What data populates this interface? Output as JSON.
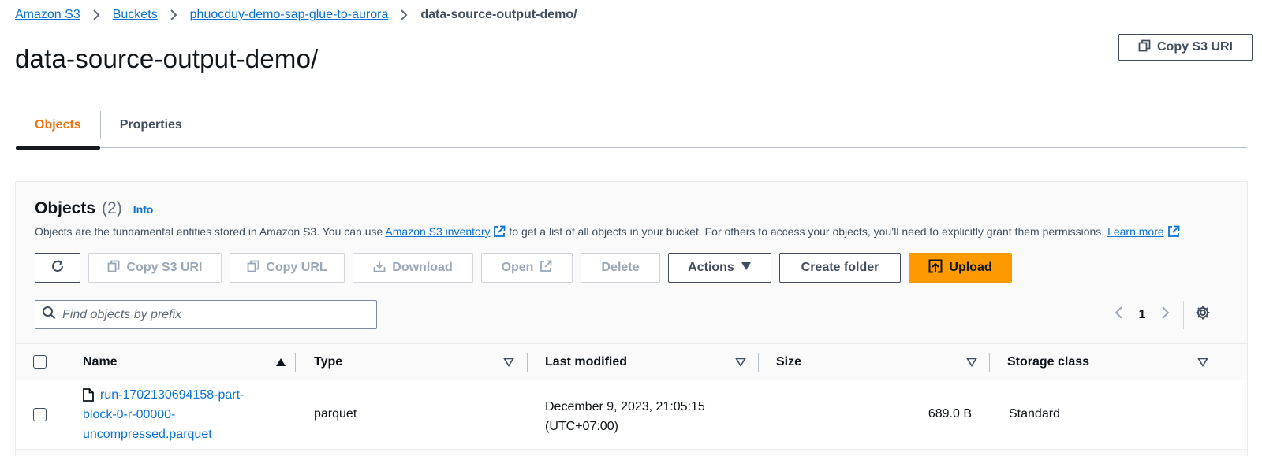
{
  "breadcrumb": {
    "items": [
      "Amazon S3",
      "Buckets",
      "phuocduy-demo-sap-glue-to-aurora"
    ],
    "current": "data-source-output-demo/"
  },
  "header": {
    "title": "data-source-output-demo/",
    "copy_uri_label": "Copy S3 URI"
  },
  "tabs": [
    {
      "label": "Objects",
      "active": true
    },
    {
      "label": "Properties",
      "active": false
    }
  ],
  "objects_panel": {
    "title": "Objects",
    "count": "(2)",
    "info_label": "Info",
    "description": {
      "part1": "Objects are the fundamental entities stored in Amazon S3. You can use ",
      "link1": "Amazon S3 inventory",
      "part2": " to get a list of all objects in your bucket. For others to access your objects, you’ll need to explicitly grant them permissions. ",
      "link2": "Learn more"
    },
    "toolbar": {
      "copy_s3_uri": "Copy S3 URI",
      "copy_url": "Copy URL",
      "download": "Download",
      "open": "Open",
      "delete": "Delete",
      "actions": "Actions",
      "create_folder": "Create folder",
      "upload": "Upload"
    },
    "search": {
      "placeholder": "Find objects by prefix",
      "value": ""
    },
    "pagination": {
      "current_page": "1"
    },
    "table": {
      "columns": [
        "Name",
        "Type",
        "Last modified",
        "Size",
        "Storage class"
      ],
      "rows": [
        {
          "name_lines": [
            "run-1702130694158-part-",
            "block-0-r-00000-",
            "uncompressed.parquet"
          ],
          "type": "parquet",
          "last_modified_lines": [
            "December 9, 2023, 21:05:15",
            "(UTC+07:00)"
          ],
          "size": "689.0 B",
          "storage_class": "Standard"
        }
      ]
    }
  },
  "colors": {
    "link": "#0972d3",
    "active_tab": "#ec7211",
    "primary_button": "#ff9900",
    "text": "#0f141a",
    "disabled": "#9ba7b6"
  }
}
